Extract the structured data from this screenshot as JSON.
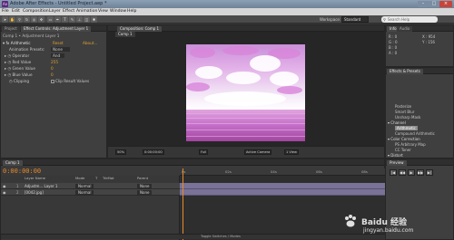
{
  "window": {
    "title": "Adobe After Effects - Untitled Project.aep *"
  },
  "menu": [
    "File",
    "Edit",
    "Composition",
    "Layer",
    "Effect",
    "Animation",
    "View",
    "Window",
    "Help"
  ],
  "toolbar": {
    "workspace_label": "Workspace:",
    "workspace_value": "Standard",
    "search_placeholder": "Search Help"
  },
  "effects_panel": {
    "tabs": [
      "Project",
      "Effect Controls: Adjustment Layer 1"
    ],
    "breadcrumb": "Comp 1 • Adjustment Layer 1",
    "effect_name": "Arithmetic",
    "reset": "Reset",
    "about": "About...",
    "rows": [
      {
        "label": "Animation Presets:",
        "value": "None"
      },
      {
        "label": "Operator",
        "value": "And"
      },
      {
        "label": "Red Value",
        "value": "255"
      },
      {
        "label": "Green Value",
        "value": "0"
      },
      {
        "label": "Blue Value",
        "value": "0"
      },
      {
        "label": "Clipping",
        "value": "Clip Result Values"
      }
    ]
  },
  "comp_panel": {
    "tab": "Composition: Comp 1",
    "subtab": "Comp 1",
    "controls": [
      "50%",
      "0:00:00:00",
      "Full",
      "Active Camera",
      "1 View"
    ],
    "colors": {
      "sky_top": "#c98ed8",
      "sea": "#c46ec9"
    }
  },
  "info_panel": {
    "tabs": [
      "Info",
      "Audio"
    ],
    "lines": [
      "R : 0",
      "G : 0",
      "B : 0",
      "A : 0",
      "X : 954",
      "Y : 156"
    ]
  },
  "fx_panel": {
    "tab": "Effects & Presets",
    "items": [
      {
        "label": "Posterize",
        "type": "item"
      },
      {
        "label": "Smart Blur",
        "type": "item"
      },
      {
        "label": "Unsharp Mask",
        "type": "item"
      },
      {
        "label": "Channel",
        "type": "cat"
      },
      {
        "label": "Arithmetic",
        "type": "sel"
      },
      {
        "label": "Compound Arithmetic",
        "type": "item"
      },
      {
        "label": "Color Correction",
        "type": "cat"
      },
      {
        "label": "PS Arbitrary Map",
        "type": "item"
      },
      {
        "label": "CC Toner",
        "type": "item"
      },
      {
        "label": "Distort",
        "type": "cat"
      }
    ]
  },
  "timeline": {
    "tab": "Comp 1",
    "time": "0:00:00:00",
    "headers": [
      "Layer Name",
      "Mode",
      "T",
      "TrkMat",
      "Parent"
    ],
    "layers": [
      {
        "num": "1",
        "name": "Adjustm... Layer 1",
        "mode": "Normal",
        "parent": "None"
      },
      {
        "num": "2",
        "name": "[0042.jpg]",
        "mode": "Normal",
        "parent": "None"
      }
    ],
    "ruler": [
      "0s",
      "02s",
      "04s",
      "06s",
      "08s"
    ],
    "footer": "Toggle Switches / Modes"
  },
  "preview": {
    "tab": "Preview",
    "buttons": [
      "|◀",
      "◀◀",
      "▶",
      "▶▶",
      "▶|"
    ]
  },
  "watermark": {
    "brand": "Baidu 经验",
    "url": "jingyan.baidu.com"
  }
}
